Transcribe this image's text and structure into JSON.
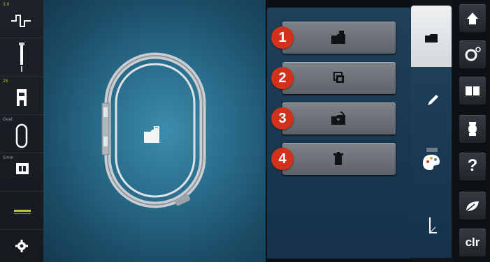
{
  "status_bar": {
    "stitch_width_label": "3.0",
    "presser_foot_label": "26",
    "hoop_label": "Oval",
    "feed_dog_label": "5mm"
  },
  "canvas": {
    "hoop_icon": "oval-hoop-graphic",
    "folder_icon": "folder-icon"
  },
  "menu": {
    "buttons": [
      {
        "number": "1",
        "icon": "folder-open-icon"
      },
      {
        "number": "2",
        "icon": "copy-icon"
      },
      {
        "number": "3",
        "icon": "save-download-icon"
      },
      {
        "number": "4",
        "icon": "trash-icon"
      }
    ]
  },
  "tabs": [
    "folder-tab",
    "edit-tab",
    "color-tab",
    "stitch-tab"
  ],
  "right_bar": {
    "buttons": [
      "home",
      "setup",
      "guide",
      "sewing-consultant",
      "help",
      "eco",
      "clr"
    ],
    "help_label": "?",
    "clr_label": "clr"
  },
  "colors": {
    "accent_red": "#d2321c",
    "status_accent": "#b8c436",
    "panel_blue": "#1e4058",
    "canvas_blue": "#2a6f8e"
  }
}
